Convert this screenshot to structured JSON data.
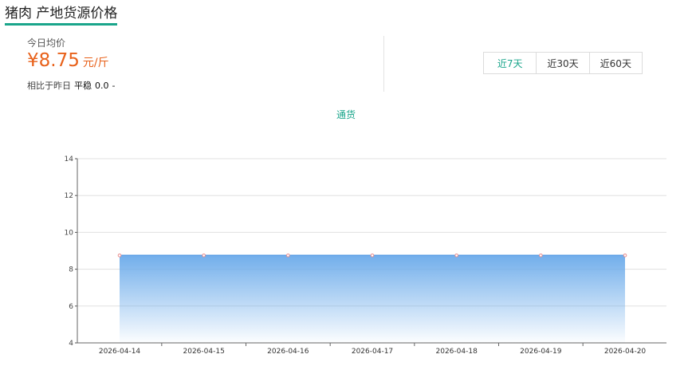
{
  "page": {
    "title": "猪肉 产地货源价格"
  },
  "summary": {
    "today_label": "今日均价",
    "price": "¥8.75",
    "unit": "元/斤",
    "compare_label": "相比于昨日",
    "compare_status": "平稳",
    "compare_value": "0.0",
    "compare_dash": "-"
  },
  "range_tabs": [
    {
      "label": "近7天",
      "active": true
    },
    {
      "label": "近30天",
      "active": false
    },
    {
      "label": "近60天",
      "active": false
    }
  ],
  "colors": {
    "accent": "#1aa58b",
    "price": "#e8611a",
    "series": "#5b9fe6",
    "point": "#e98b8b"
  },
  "chart_data": {
    "type": "area",
    "x": [
      "2026-04-14",
      "2026-04-15",
      "2026-04-16",
      "2026-04-17",
      "2026-04-18",
      "2026-04-19",
      "2026-04-20"
    ],
    "series": [
      {
        "name": "通货",
        "values": [
          8.75,
          8.75,
          8.75,
          8.75,
          8.75,
          8.75,
          8.75
        ]
      }
    ],
    "ylim": [
      4,
      14
    ],
    "yticks": [
      4,
      6,
      8,
      10,
      12,
      14
    ],
    "grid": true,
    "legend_position": "top-center"
  }
}
